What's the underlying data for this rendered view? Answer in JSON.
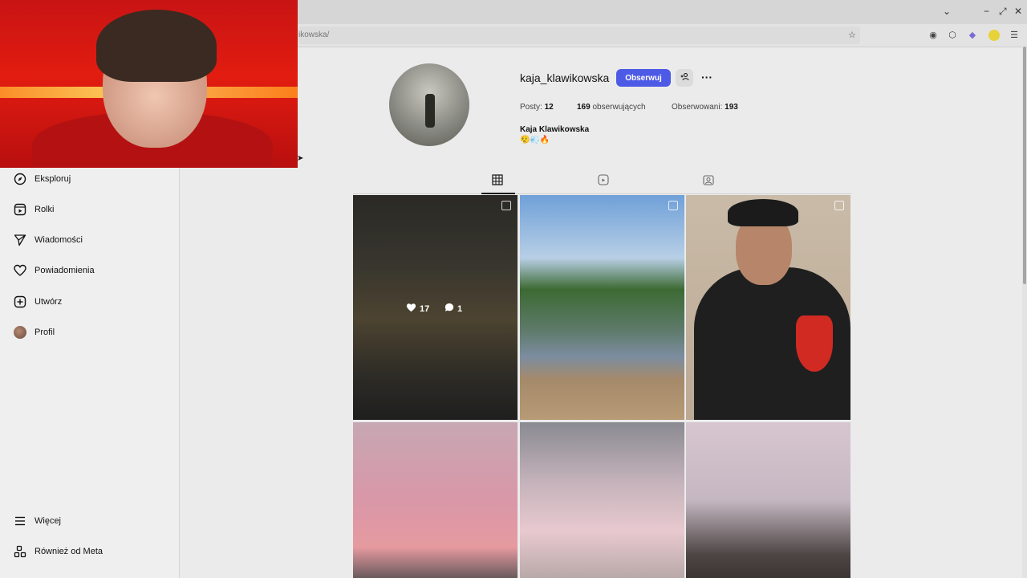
{
  "browser": {
    "url": "ikowska/",
    "window_controls": [
      "⌄",
      "−",
      "⤢",
      "✕"
    ]
  },
  "sidebar": {
    "items": [
      {
        "label": "Eksploruj",
        "icon": "compass-icon"
      },
      {
        "label": "Rolki",
        "icon": "reels-icon"
      },
      {
        "label": "Wiadomości",
        "icon": "send-icon"
      },
      {
        "label": "Powiadomienia",
        "icon": "heart-icon"
      },
      {
        "label": "Utwórz",
        "icon": "plus-square-icon"
      },
      {
        "label": "Profil",
        "icon": "avatar"
      }
    ],
    "bottom": [
      {
        "label": "Więcej",
        "icon": "hamburger-icon"
      },
      {
        "label": "Również od Meta",
        "icon": "grid-icon"
      }
    ]
  },
  "profile": {
    "username": "kaja_klawikowska",
    "follow_label": "Obserwuj",
    "posts_label": "Posty:",
    "posts_count": "12",
    "followers_count": "169",
    "followers_label": "obserwujących",
    "following_label": "Obserwowani:",
    "following_count": "193",
    "full_name": "Kaja Klawikowska",
    "bio": "😮‍💨💨🔥"
  },
  "first_post": {
    "likes": "17",
    "comments": "1"
  }
}
